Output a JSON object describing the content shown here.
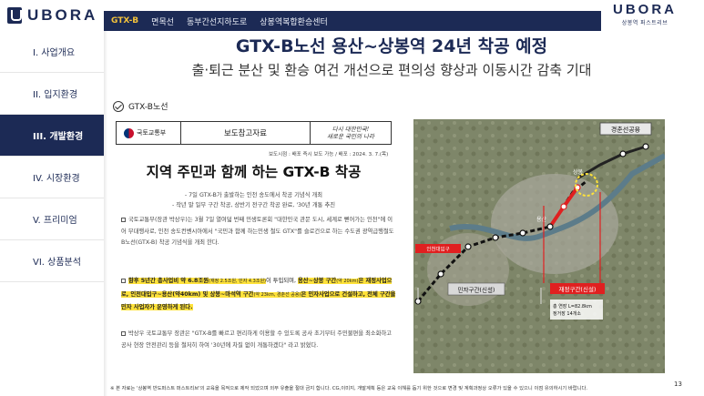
{
  "brand": {
    "logo_text": "UBORA",
    "logo_right_text": "UBORA",
    "logo_right_sub": "상봉역 퍼스트리브"
  },
  "topbar": {
    "tabs": [
      {
        "label": "GTX-B",
        "active": true
      },
      {
        "label": "면목선",
        "active": false
      },
      {
        "label": "동부간선지하도로",
        "active": false
      },
      {
        "label": "상봉역복합환승센터",
        "active": false
      }
    ]
  },
  "sidebar": {
    "items": [
      {
        "label": "I. 사업개요",
        "active": false
      },
      {
        "label": "II. 입지환경",
        "active": false
      },
      {
        "label": "III. 개발환경",
        "active": true
      },
      {
        "label": "IV. 시장환경",
        "active": false
      },
      {
        "label": "V. 프리미엄",
        "active": false
      },
      {
        "label": "VI. 상품분석",
        "active": false
      }
    ]
  },
  "header": {
    "title": "GTX-B노선 용산~상봉역 24년 착공 예정",
    "subtitle": "출·퇴근 분산 및 환승 여건 개선으로 편의성 향상과 이동시간 감축 기대"
  },
  "section": {
    "label": "GTX-B노선"
  },
  "press": {
    "ministry": "국토교통부",
    "doc_type": "보도참고자료",
    "slogan_line1": "다시 대한민국!",
    "slogan_line2": "새로운 국민의 나라",
    "meta": "보도시점 : 배포 즉시 보도 가능 / 배포 : 2024. 3. 7.(목)",
    "headline": "지역 주민과 함께 하는 GTX-B 착공",
    "sub1": "- 7일 GTX-B가 출발하는 인천 송도에서 착공 기념식 개최",
    "sub2": "- 작년 말 일부 구간 착공, 상반기 전구간 착공 완료, '30년 개통 추진",
    "para1": "국토교통부(장관 박상우)는 3월 7일 열여덟 번째 민생토론회 \"대한민국 관문 도시, 세계로 뻗어가는 인천\"에 이어 부대행사로, 인천 송도컨벤시아에서 \"국민과 함께 하는민생 철도 GTX\"를 슬로건으로 하는 수도권 광역급행철도 B노선(GTX-B) 착공 기념식을 개최 한다.",
    "hl_a": "향후 5년간 총사업비 약 6.8조원",
    "hl_b": "(재정 2.5조원, 민자 4.3조원)",
    "hl_c": "이 투입되며, ",
    "hl_d": "용산~상봉 구간",
    "hl_e": "(약 20km)",
    "hl_f": "은 재정사업으로, 인천대입구~용산(약40km) 및 상봉~마석역 구간",
    "hl_g": "(약 23km, 경춘선 공용)",
    "hl_h": "은 민자사업으로 건설하고, 전체 구간을 민자 사업자가 운영하게 된다.",
    "para3": "박상우 국토교통부 장관은 \"GTX-B를 빠르고 편리하게 이용할 수 있도록 공사 초기부터 주민불편을 최소화하고 공사 현장 안전관리 등을 철저히 하여 '30년에 차질 없이 개통하겠다\" 라고 밝혔다."
  },
  "map": {
    "label_top": "경춘선공용",
    "label_public": "민자구간(신설)",
    "label_finance": "재정구간(신설)",
    "label_songdo": "인천대입구",
    "label_sangbong": "상봉",
    "label_yongsan": "용산",
    "label_legend1": "총 연장 L=82.8km",
    "label_legend2": "정거장 14개소"
  },
  "footer": {
    "note": "※ 본 자료는 '상봉역 반도퍼스트 퍼스트리브'의 교육을 목적으로 제작 되었으며 외부 유출을 절대 금지 합니다. CG,이미지, 개발계획 등은 교육 이해를 돕기 위한 것으로 변경 및 계획과정상 오류가 있을 수 있으니 이점 유의하시기 바랍니다.",
    "page": "13"
  },
  "colors": {
    "navy": "#1c2a55",
    "gold": "#f3c23b",
    "highlight": "#ffe23a",
    "red": "#e02020"
  }
}
